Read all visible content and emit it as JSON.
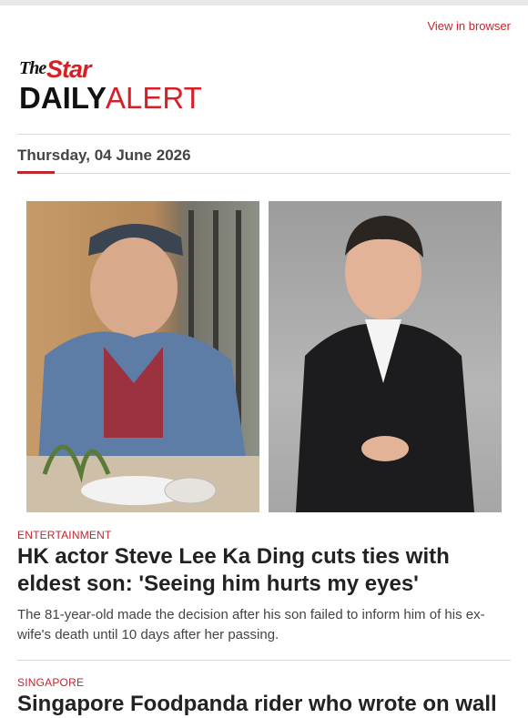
{
  "header": {
    "view_in_browser": "View in browser"
  },
  "logo": {
    "the": "The",
    "star": "Star",
    "daily": "DAILY",
    "alert": "ALERT"
  },
  "date": "Thursday, 04 June 2026",
  "colors": {
    "accent": "#c0262d",
    "brand_red": "#d71f26"
  },
  "articles": [
    {
      "category": "ENTERTAINMENT",
      "headline": "HK actor Steve Lee Ka Ding cuts ties with eldest son: 'Seeing him hurts my eyes'",
      "summary": "The 81-year-old made the decision after his son failed to inform him of his ex-wife's death until 10 days after her passing."
    },
    {
      "category": "SINGAPORE",
      "headline": "Singapore Foodpanda rider who wrote on wall"
    }
  ]
}
